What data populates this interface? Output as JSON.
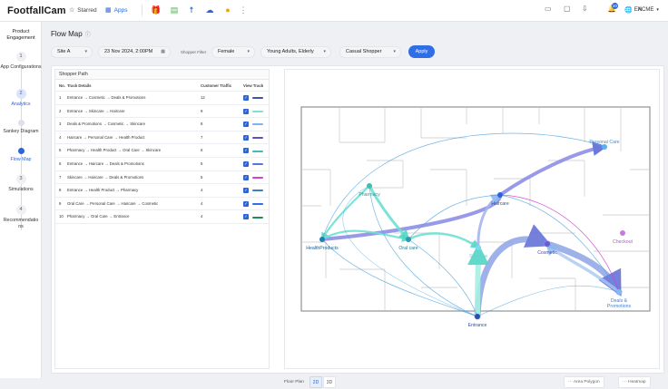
{
  "app": {
    "logo": "FootfallCam"
  },
  "nav": {
    "starred": "Starred",
    "apps": "Apps"
  },
  "topbar": {
    "language": "EN",
    "user": "ACME",
    "notification_count": "20"
  },
  "sidebar": {
    "title": "Product Engagement",
    "steps": [
      {
        "num": "1",
        "label": "App Configurations"
      },
      {
        "num": "2",
        "label": "Analytics"
      },
      {
        "label": "Sankey Diagram"
      },
      {
        "label": "Flow Map"
      },
      {
        "num": "3",
        "label": "Simulations"
      },
      {
        "num": "4",
        "label": "Recommendations"
      }
    ]
  },
  "page": {
    "title": "Flow Map"
  },
  "filters": {
    "site": "Site A",
    "date": "23 Nov 2024, 2:00PM",
    "shopper_filter_label": "Shopper Filter",
    "gender": "Female",
    "age": "Young Adults, Elderly",
    "type": "Casual Shopper",
    "apply": "Apply"
  },
  "table": {
    "title": "Shopper Path",
    "headers": [
      "No.",
      "Track Details",
      "Customer Traffic",
      "View Track"
    ],
    "rows": [
      {
        "no": "1",
        "track": "Entrance → Cosmetic → Deals & Promotions",
        "traffic": "12",
        "color": "#3f51b5"
      },
      {
        "no": "2",
        "track": "Entrance → Skincare → Haircare",
        "traffic": "9",
        "color": "#7fe0d4"
      },
      {
        "no": "3",
        "track": "Deals & Promotions → Cosmetic → Skincare",
        "traffic": "8",
        "color": "#7fb2ef"
      },
      {
        "no": "4",
        "track": "Haircare → Personal Care → Health Product",
        "traffic": "7",
        "color": "#5d4fc6"
      },
      {
        "no": "5",
        "track": "Pharmacy → Health Product → Oral Care → Skincare",
        "traffic": "6",
        "color": "#3fbfb0"
      },
      {
        "no": "6",
        "track": "Entrance → Haircare → Deals & Promotions",
        "traffic": "5",
        "color": "#5577dd"
      },
      {
        "no": "7",
        "track": "Skincare → Haircare → Deals & Promotions",
        "traffic": "5",
        "color": "#d43fd4"
      },
      {
        "no": "8",
        "track": "Entrance → Health Product → Pharmacy",
        "traffic": "4",
        "color": "#3b7fc4"
      },
      {
        "no": "9",
        "track": "Oral Care → Personal Care → Haircare → Cosmetic",
        "traffic": "4",
        "color": "#2f6ee6"
      },
      {
        "no": "10",
        "track": "Pharmacy → Oral Care → Entrance",
        "traffic": "4",
        "color": "#1f8a5a"
      }
    ]
  },
  "map": {
    "nodes": {
      "personal_care": "Personal Care",
      "pharmacy": "Pharmacy",
      "haircare": "Haircare",
      "checkout": "Checkout",
      "health_products": "HealthProducts",
      "oral_care": "Oral care",
      "skincare": "Skincare",
      "cosmetic": "Cosmetic",
      "deals": "Deals & Promotions",
      "entrance": "Entrance"
    }
  },
  "bottom": {
    "floor_plan": "Floor Plan",
    "view_2d": "2D",
    "view_3d": "3D",
    "area_polygon": "Area Polygon",
    "heatmap": "Heatmap"
  }
}
